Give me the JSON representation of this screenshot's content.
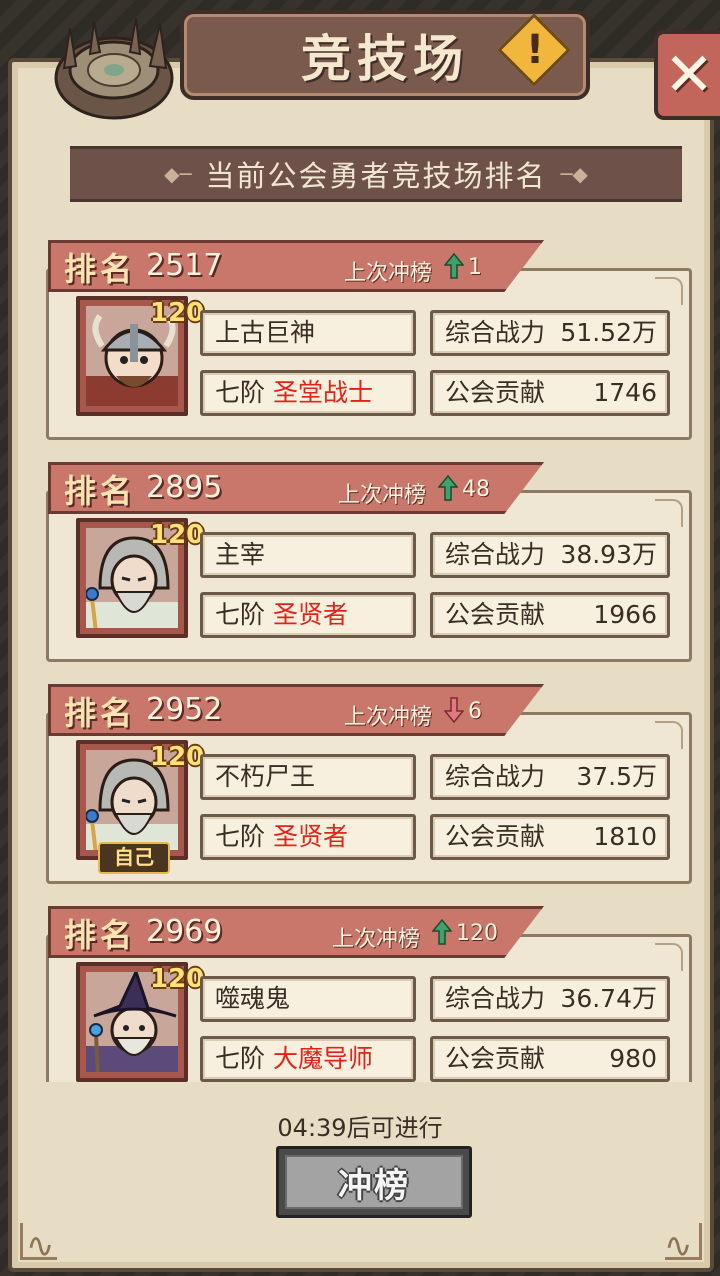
{
  "header": {
    "title": "竞技场",
    "info_icon": "warning-icon",
    "close_icon": "close-icon"
  },
  "subtitle": "当前公会勇者竞技场排名",
  "rank_label": "排名",
  "last_label": "上次冲榜",
  "power_label": "综合战力",
  "contrib_label": "公会贡献",
  "stage_label": "七阶",
  "level": "120",
  "self_tag": "自己",
  "colors": {
    "up": "#3ea36a",
    "down": "#e07a80",
    "class_text": "#e2231a"
  },
  "entries": [
    {
      "rank": "2517",
      "change_dir": "up",
      "change": "1",
      "name": "上古巨神",
      "class": "圣堂战士",
      "power": "51.52万",
      "contribution": "1746",
      "avatar": "viking-warrior",
      "self": false
    },
    {
      "rank": "2895",
      "change_dir": "up",
      "change": "48",
      "name": "主宰",
      "class": "圣贤者",
      "power": "38.93万",
      "contribution": "1966",
      "avatar": "elder-sage",
      "self": false
    },
    {
      "rank": "2952",
      "change_dir": "down",
      "change": "6",
      "name": "不朽尸王",
      "class": "圣贤者",
      "power": "37.5万",
      "contribution": "1810",
      "avatar": "elder-sage",
      "self": true
    },
    {
      "rank": "2969",
      "change_dir": "up",
      "change": "120",
      "name": "噬魂鬼",
      "class": "大魔导师",
      "power": "36.74万",
      "contribution": "980",
      "avatar": "wizard",
      "self": false
    }
  ],
  "footer": {
    "timer": "04:39后可进行",
    "button": "冲榜"
  }
}
